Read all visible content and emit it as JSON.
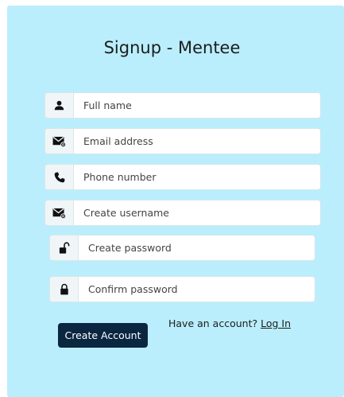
{
  "page": {
    "title": "Signup - Mentee"
  },
  "form": {
    "full_name": {
      "placeholder": "Full name",
      "icon": "user-icon"
    },
    "email": {
      "placeholder": "Email address",
      "icon": "envelope-icon"
    },
    "phone": {
      "placeholder": "Phone number",
      "icon": "phone-icon"
    },
    "username": {
      "placeholder": "Create username",
      "icon": "envelope-icon"
    },
    "password": {
      "placeholder": "Create password",
      "icon": "unlock-icon"
    },
    "confirm_password": {
      "placeholder": "Confirm password",
      "icon": "lock-icon"
    }
  },
  "actions": {
    "create_account_label": "Create Account",
    "have_account_text": "Have an account?",
    "login_link_label": "Log In"
  },
  "colors": {
    "panel_background": "#baeefc",
    "button_background": "#0b2640",
    "button_text": "#ffffff"
  }
}
